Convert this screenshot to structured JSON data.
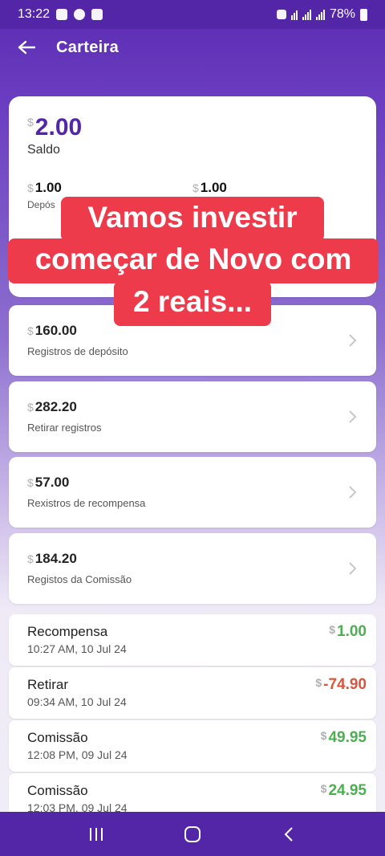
{
  "status_bar": {
    "time": "13:22",
    "battery": "78%"
  },
  "app_bar": {
    "title": "Carteira"
  },
  "currency_symbol": "$",
  "balance": {
    "amount": "2.00",
    "label": "Saldo",
    "sub_left_amount": "1.00",
    "sub_left_label": "Depós",
    "sub_right_amount": "1.00"
  },
  "overlay": {
    "line1": "Vamos investir",
    "line2": "começar de Novo com",
    "line3": "2 reais..."
  },
  "records": [
    {
      "amount": "160.00",
      "label": "Registros de depósito"
    },
    {
      "amount": "282.20",
      "label": "Retirar registros"
    },
    {
      "amount": "57.00",
      "label": "Rexistros de recompensa"
    },
    {
      "amount": "184.20",
      "label": "Registos da Comissão"
    }
  ],
  "transactions": [
    {
      "title": "Recompensa",
      "date": "10:27 AM, 10 Jul 24",
      "amount": "1.00"
    },
    {
      "title": "Retirar",
      "date": "09:34 AM, 10 Jul 24",
      "amount": "-74.90"
    },
    {
      "title": "Comissão",
      "date": "12:08 PM, 09 Jul 24",
      "amount": "49.95"
    },
    {
      "title": "Comissão",
      "date": "12:03 PM, 09 Jul 24",
      "amount": "24.95"
    }
  ],
  "colors": {
    "primary": "#5326a8",
    "positive": "#4caf50",
    "negative": "#d9553c",
    "overlay": "#ee3b4c"
  }
}
